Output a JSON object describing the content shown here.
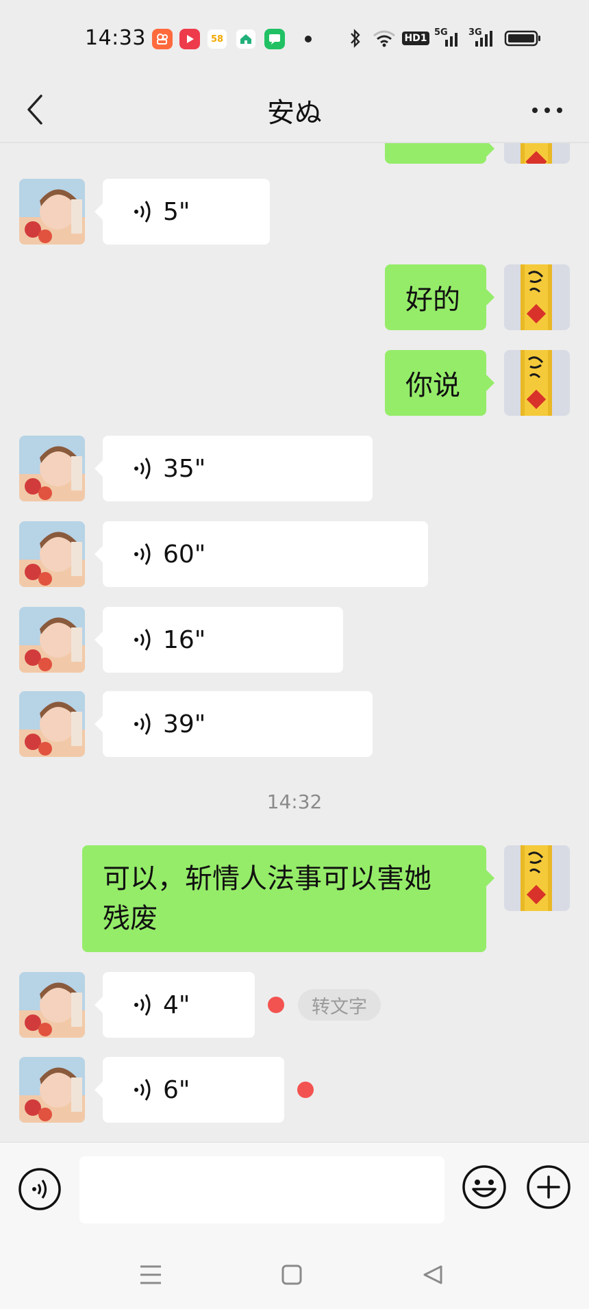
{
  "status_bar": {
    "time": "14:33",
    "app_icons": [
      "kuaishou-icon",
      "video-app-icon",
      "58-app-icon",
      "home-app-icon",
      "chat-app-icon"
    ],
    "app_58_label": "58",
    "signal_5g": "5G",
    "signal_3g": "3G",
    "hd_label": "HD1"
  },
  "header": {
    "title": "安ぬ"
  },
  "messages": [
    {
      "side": "left",
      "type": "voice",
      "duration": "5\""
    },
    {
      "side": "right",
      "type": "text",
      "text": "好的"
    },
    {
      "side": "right",
      "type": "text",
      "text": "你说"
    },
    {
      "side": "left",
      "type": "voice",
      "duration": "35\""
    },
    {
      "side": "left",
      "type": "voice",
      "duration": "60\""
    },
    {
      "side": "left",
      "type": "voice",
      "duration": "16\""
    },
    {
      "side": "left",
      "type": "voice",
      "duration": "39\""
    },
    {
      "type": "timestamp",
      "text": "14:32"
    },
    {
      "side": "right",
      "type": "text",
      "text_line1": "可以，斩情人法事可以害她",
      "text_line2": "残废"
    },
    {
      "side": "left",
      "type": "voice",
      "duration": "4\"",
      "unread": true,
      "action_label": "转文字"
    },
    {
      "side": "left",
      "type": "voice",
      "duration": "6\"",
      "unread": true
    }
  ],
  "colors": {
    "background": "#ededed",
    "own_bubble": "#95ec69",
    "other_bubble": "#ffffff",
    "unread_dot": "#f35350",
    "timestamp_text": "#8a8a8a"
  },
  "input_bar": {
    "value": "",
    "placeholder": ""
  }
}
